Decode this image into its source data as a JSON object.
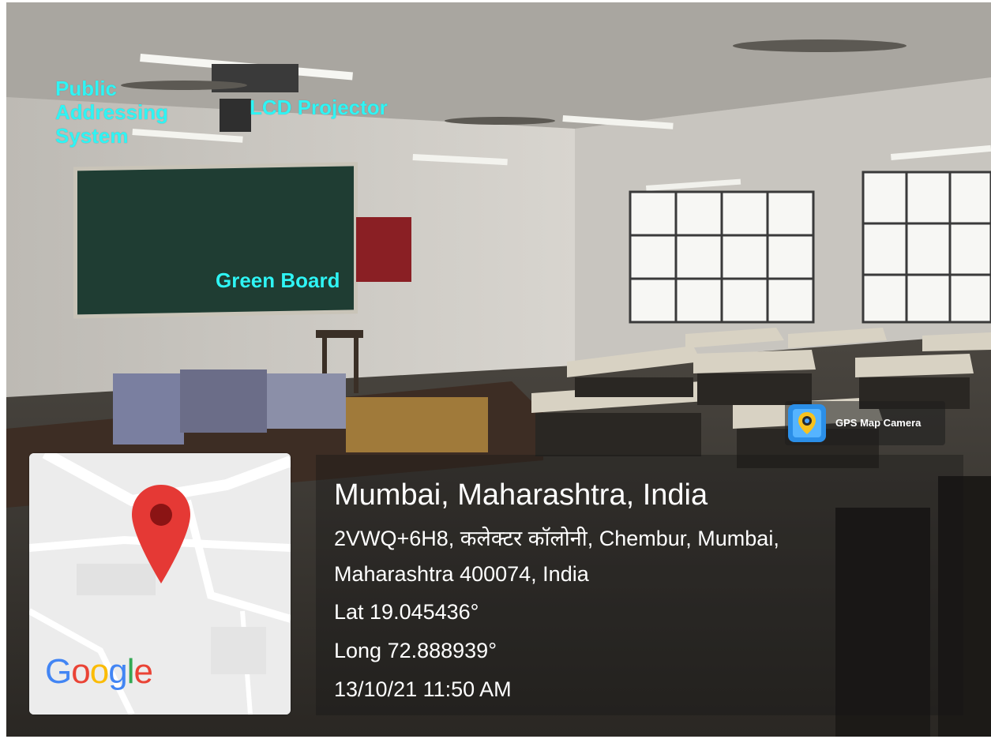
{
  "annotations": {
    "pa_system": "Public\nAddressing\nSystem",
    "lcd_projector": "LCD Projector",
    "green_board": "Green Board"
  },
  "gps_badge": {
    "label": "GPS Map Camera",
    "icon": "map-camera-icon"
  },
  "location": {
    "title": "Mumbai, Maharashtra, India",
    "address_line1": "2VWQ+6H8, कलेक्टर कॉलोनी, Chembur, Mumbai,",
    "address_line2": "Maharashtra 400074, India",
    "lat": "Lat 19.045436°",
    "long": "Long 72.888939°",
    "datetime": "13/10/21 11:50 AM"
  },
  "map": {
    "logo": "Google",
    "pin_icon": "map-pin-icon",
    "colors": {
      "pin": "#e53935",
      "pin_dot": "#8b1414"
    }
  },
  "colors": {
    "label": "#2ff4f4",
    "board": "#1f3d33",
    "google_blue": "#4285F4",
    "google_red": "#EA4335",
    "google_yellow": "#FBBC05",
    "google_green": "#34A853"
  }
}
